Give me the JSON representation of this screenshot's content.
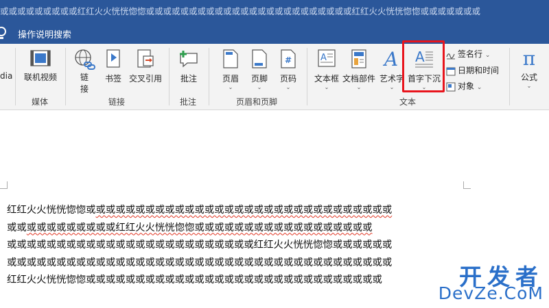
{
  "window": {
    "title": "或或或或或或或或或红红火火恍恍惚惚或或或或或或或或或或或或或或或或或或或或或或或或红红火火恍恍惚惚或或或或或或或"
  },
  "tell_me": {
    "text": "操作说明搜索"
  },
  "ribbon": {
    "media": {
      "partial_label": "dia",
      "online_video": "联机视频",
      "group": "媒体"
    },
    "links": {
      "link": "链\n接",
      "link_line1": "链",
      "link_line2": "接",
      "bookmark": "书签",
      "cross_ref": "交叉引用",
      "group": "链接"
    },
    "comments": {
      "comment": "批注",
      "group": "批注"
    },
    "header_footer": {
      "header": "页眉",
      "footer": "页脚",
      "page_number": "页码",
      "group": "页眉和页脚"
    },
    "text": {
      "text_box": "文本框",
      "quick_parts": "文档部件",
      "wordart": "艺术字",
      "drop_cap": "首字下沉",
      "signature_line": "签名行",
      "date_time": "日期和时间",
      "object": "对象",
      "group": "文本"
    },
    "symbols": {
      "equation": "公式",
      "equation_glyph": "π"
    }
  },
  "document": {
    "lines": [
      [
        "红红火火恍恍惚惚或",
        "或或或或或或或或或或或或或或或或或或或或或或或或或或或或或或"
      ],
      [
        "或或",
        "或或或或或或或或或红红火火恍恍惚惚或或或或或或或或或或或或或或或或或或"
      ],
      [
        "",
        "或或或或或或或或或或或或或或或或或或或或或或或或或红红火火恍恍惚惚或或或或或或"
      ],
      [
        "",
        "或或或或或或或或或或或或或或或或或或或或或或或或或或或或或或或或或或或或或或或"
      ],
      [
        "",
        "红红火火恍恍惚惚或或或或或或或或或或或或或或或或或或或或或或或或或或或或或或"
      ]
    ]
  },
  "watermark": {
    "line1": "开发者",
    "line2": "DevZe.CoM"
  }
}
